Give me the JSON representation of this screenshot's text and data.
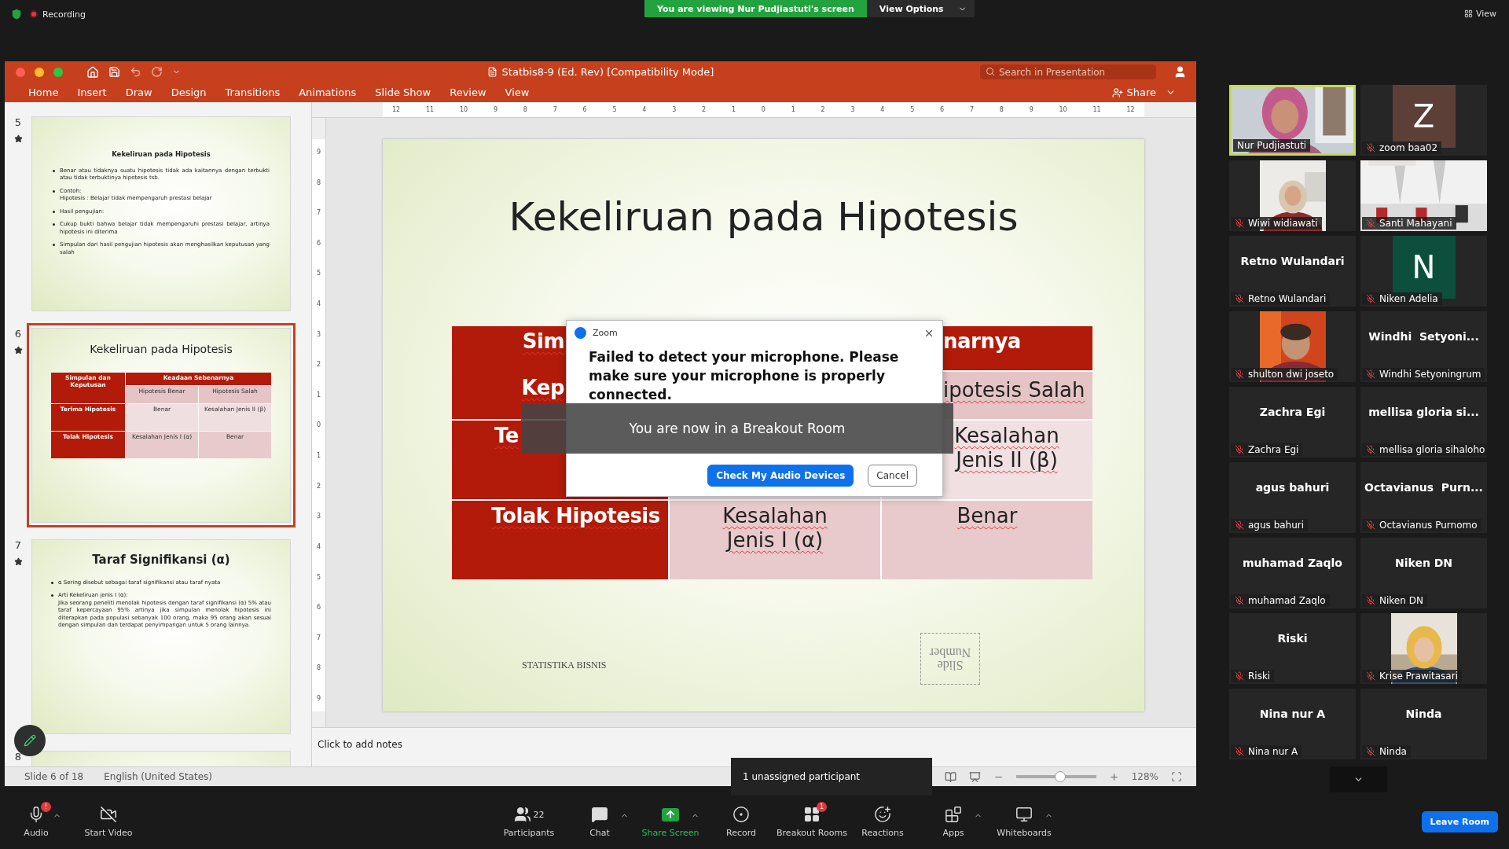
{
  "top_bar": {
    "recording": "Recording",
    "viewing_banner": "You are viewing Nur Pudjiastuti's screen",
    "view_options": "View Options",
    "view": "View"
  },
  "powerpoint": {
    "title": "Statbis8-9 (Ed. Rev) [Compatibility Mode]",
    "search": {
      "placeholder": "Search in Presentation"
    },
    "ribbon_tabs": [
      "Home",
      "Insert",
      "Draw",
      "Design",
      "Transitions",
      "Animations",
      "Slide Show",
      "Review",
      "View"
    ],
    "share": "Share",
    "thumbnails": [
      {
        "number": "5",
        "kind": "text",
        "selected": false,
        "title": "Kekeliruan pada Hipotesis",
        "bullets": [
          {
            "text": "Benar atau tidaknya suatu hipotesis tidak ada kaitannya dengan terbukti atau tidak terbuktinya  hipotesis tsb."
          },
          {
            "text": "Contoh:",
            "sub": "Hipotesis : Belajar tidak mempengaruh prestasi belajar"
          },
          {
            "text": "Hasil pengujian:"
          },
          {
            "text": "Cukup bukti bahwa belajar tidak mempengaruhi prestasi belajar, artinya      hipotesis ini diterima"
          },
          {
            "text": "Simpulan dari hasil pengujian hipotesis akan menghasilkan keputusan yang salah"
          }
        ]
      },
      {
        "number": "6",
        "kind": "table",
        "selected": true,
        "title": "Kekeliruan pada Hipotesis",
        "table": {
          "corner": "Simpulan dan Keputusan",
          "header": "Keadaan Sebenarnya",
          "subheaders": [
            "Hipotesis Benar",
            "Hipotesis Salah"
          ],
          "rows": [
            {
              "label": "Terima Hipotesis",
              "cells": [
                "Benar",
                "Kesalahan Jenis II (β)"
              ]
            },
            {
              "label": "Tolak Hipotesis",
              "cells": [
                "Kesalahan Jenis I (α)",
                "Benar"
              ]
            }
          ]
        }
      },
      {
        "number": "7",
        "kind": "heading",
        "selected": false,
        "title": "Taraf Signifikansi (α)",
        "bullets": [
          {
            "text": "α Sering disebut sebagai taraf signifikansi atau taraf nyata"
          },
          {
            "text": "Arti Kekeliruan jenis I (α):",
            "sub": "Jika seorang peneliti menolak hipotesis dengan taraf signifikansi (α) 5% atau taraf kepercayaan 95% artinya jika simpulan menolak hipotesis ini diterapkan pada populasi sebanyak 100 orang, maka 95 orang akan sesuai dengan simpulan dan terdapat penyimpangan untuk 5 orang lainnya."
          }
        ]
      },
      {
        "number": "8",
        "kind": "cut",
        "selected": false
      }
    ],
    "ruler_h": [
      "12",
      "11",
      "10",
      "9",
      "8",
      "7",
      "6",
      "5",
      "4",
      "3",
      "2",
      "1",
      "0",
      "1",
      "2",
      "3",
      "4",
      "5",
      "6",
      "7",
      "8",
      "9",
      "10",
      "11",
      "12"
    ],
    "ruler_v": [
      "9",
      "8",
      "7",
      "6",
      "5",
      "4",
      "3",
      "2",
      "1",
      "0",
      "1",
      "2",
      "3",
      "4",
      "5",
      "6",
      "7",
      "8",
      "9"
    ],
    "slide": {
      "title": "Kekeliruan pada Hipotesis",
      "table": {
        "corner": [
          "Sim",
          "Kep"
        ],
        "header": "narnya",
        "subheaders": [
          "ipotesis Salah"
        ],
        "rows": [
          {
            "label": "Te",
            "cells": [
              null,
              "Kesalahan Jenis II (β)"
            ]
          },
          {
            "label": "Tolak Hipotesis",
            "cells": [
              "Kesalahan Jenis I (α)",
              "Benar"
            ]
          }
        ]
      },
      "footer": "STATISTIKA BISNIS",
      "number_placeholder": "Slide Number"
    },
    "notes": {
      "placeholder": "Click to add notes"
    },
    "status_bar": {
      "slide_count": "Slide 6 of 18",
      "language": "English (United States)",
      "zoom": {
        "level": 0.55
      },
      "zoom_percent": "128%"
    }
  },
  "dialog": {
    "title": "Zoom",
    "message": "Failed to detect your microphone. Please make sure your microphone is properly connected.",
    "buttons": [
      {
        "label": "Check My Audio Devices",
        "primary": true
      },
      {
        "label": "Cancel",
        "primary": false
      }
    ]
  },
  "toast": "You are now in a Breakout Room",
  "tooltip": "1 unassigned participant",
  "participants": [
    {
      "kind": "widevideo",
      "label": "Nur Pudjiastuti",
      "muted": false,
      "speaking": true
    },
    {
      "kind": "avatar",
      "initial": "Z",
      "color": "#5c4037",
      "label": "zoom baa02",
      "muted": true,
      "speaking": false
    },
    {
      "kind": "video",
      "label": "Wiwi widiawati",
      "muted": true,
      "speaking": false
    },
    {
      "kind": "widevideo",
      "label": "Santi Mahayani",
      "muted": true,
      "speaking": false
    },
    {
      "kind": "name",
      "name": "Retno Wulandari",
      "label": "Retno Wulandari",
      "muted": true,
      "speaking": false
    },
    {
      "kind": "avatar",
      "initial": "N",
      "color": "#0b4f3c",
      "label": "Niken Adelia",
      "muted": true,
      "speaking": false
    },
    {
      "kind": "video",
      "label": "shulton dwi joseto",
      "muted": true,
      "speaking": false
    },
    {
      "kind": "name",
      "name": "Windhi  Setyoni...",
      "label": "Windhi Setyoningrum",
      "muted": true,
      "speaking": false
    },
    {
      "kind": "name",
      "name": "Zachra Egi",
      "label": "Zachra Egi",
      "muted": true,
      "speaking": false
    },
    {
      "kind": "name",
      "name": "mellisa gloria si...",
      "label": "mellisa gloria sihaloho",
      "muted": true,
      "speaking": false
    },
    {
      "kind": "name",
      "name": "agus bahuri",
      "label": "agus bahuri",
      "muted": true,
      "speaking": false
    },
    {
      "kind": "name",
      "name": "Octavianus  Purn...",
      "label": "Octavianus Purnomo",
      "muted": true,
      "speaking": false
    },
    {
      "kind": "name",
      "name": "muhamad Zaqlo",
      "label": "muhamad Zaqlo",
      "muted": true,
      "speaking": false
    },
    {
      "kind": "name",
      "name": "Niken DN",
      "label": "Niken DN",
      "muted": true,
      "speaking": false
    },
    {
      "kind": "name",
      "name": "Riski",
      "label": "Riski",
      "muted": true,
      "speaking": false
    },
    {
      "kind": "video",
      "label": "Krise Prawitasari",
      "muted": true,
      "speaking": false
    },
    {
      "kind": "name",
      "name": "Nina nur A",
      "label": "Nina nur A",
      "muted": true,
      "speaking": false
    },
    {
      "kind": "name",
      "name": "Ninda",
      "label": "Ninda",
      "muted": true,
      "speaking": false
    }
  ],
  "toolbar": [
    {
      "kind": "audio",
      "label": "Audio",
      "badge": "!",
      "caret": true
    },
    {
      "kind": "video",
      "label": "Start Video",
      "caret": false
    },
    {
      "kind": "participants",
      "label": "Participants",
      "count": "22",
      "caret": false
    },
    {
      "kind": "chat",
      "label": "Chat",
      "caret": true
    },
    {
      "kind": "share",
      "label": "Share Screen",
      "caret": true
    },
    {
      "kind": "record",
      "label": "Record",
      "caret": false
    },
    {
      "kind": "breakout",
      "label": "Breakout Rooms",
      "badge": "1",
      "caret": false
    },
    {
      "kind": "reactions",
      "label": "Reactions",
      "caret": false
    },
    {
      "kind": "apps",
      "label": "Apps",
      "caret": true
    },
    {
      "kind": "whiteboards",
      "label": "Whiteboards",
      "caret": true
    }
  ],
  "leave": "Leave Room"
}
